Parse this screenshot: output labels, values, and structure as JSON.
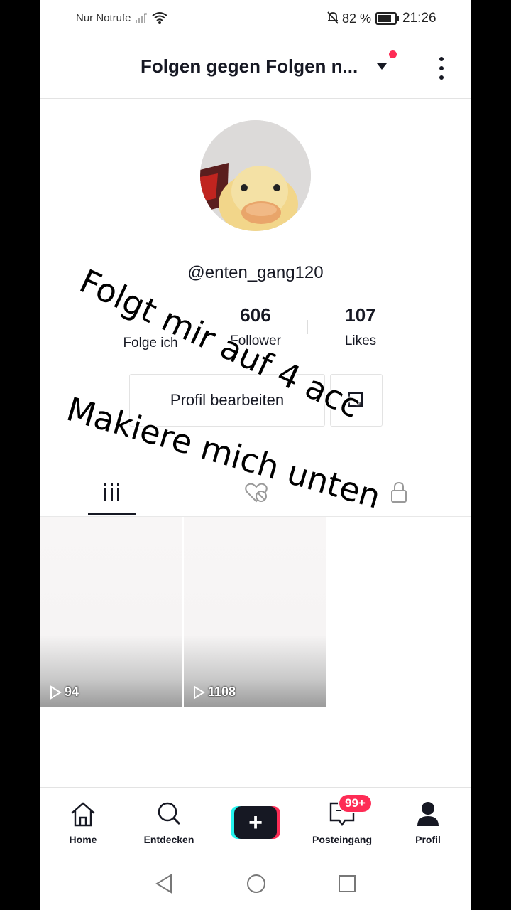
{
  "status_bar": {
    "carrier": "Nur Notrufe",
    "battery": "82 %",
    "time": "21:26"
  },
  "header": {
    "account_name": "Folgen gegen Folgen n...",
    "has_notification_dot": true
  },
  "profile": {
    "username": "@enten_gang120",
    "stats": [
      {
        "value": "",
        "label": "Folge ich"
      },
      {
        "value": "606",
        "label": "Follower"
      },
      {
        "value": "107",
        "label": "Likes"
      }
    ],
    "edit_button": "Profil bearbeiten"
  },
  "overlay_text": {
    "line1": "Folgt mir auf 4 acc",
    "line2": "Makiere mich unten"
  },
  "tabs": [
    {
      "icon": "grid-icon",
      "selected": true
    },
    {
      "icon": "liked-hidden-icon",
      "selected": false
    },
    {
      "icon": "lock-icon",
      "selected": false
    }
  ],
  "videos": [
    {
      "views": "94"
    },
    {
      "views": "1108"
    }
  ],
  "bottom_nav": {
    "home": "Home",
    "discover": "Entdecken",
    "create": "+",
    "inbox": "Posteingang",
    "inbox_badge": "99+",
    "profile": "Profil"
  },
  "colors": {
    "accent": "#fe2c55",
    "cyan": "#25f4ee",
    "text": "#161823"
  }
}
